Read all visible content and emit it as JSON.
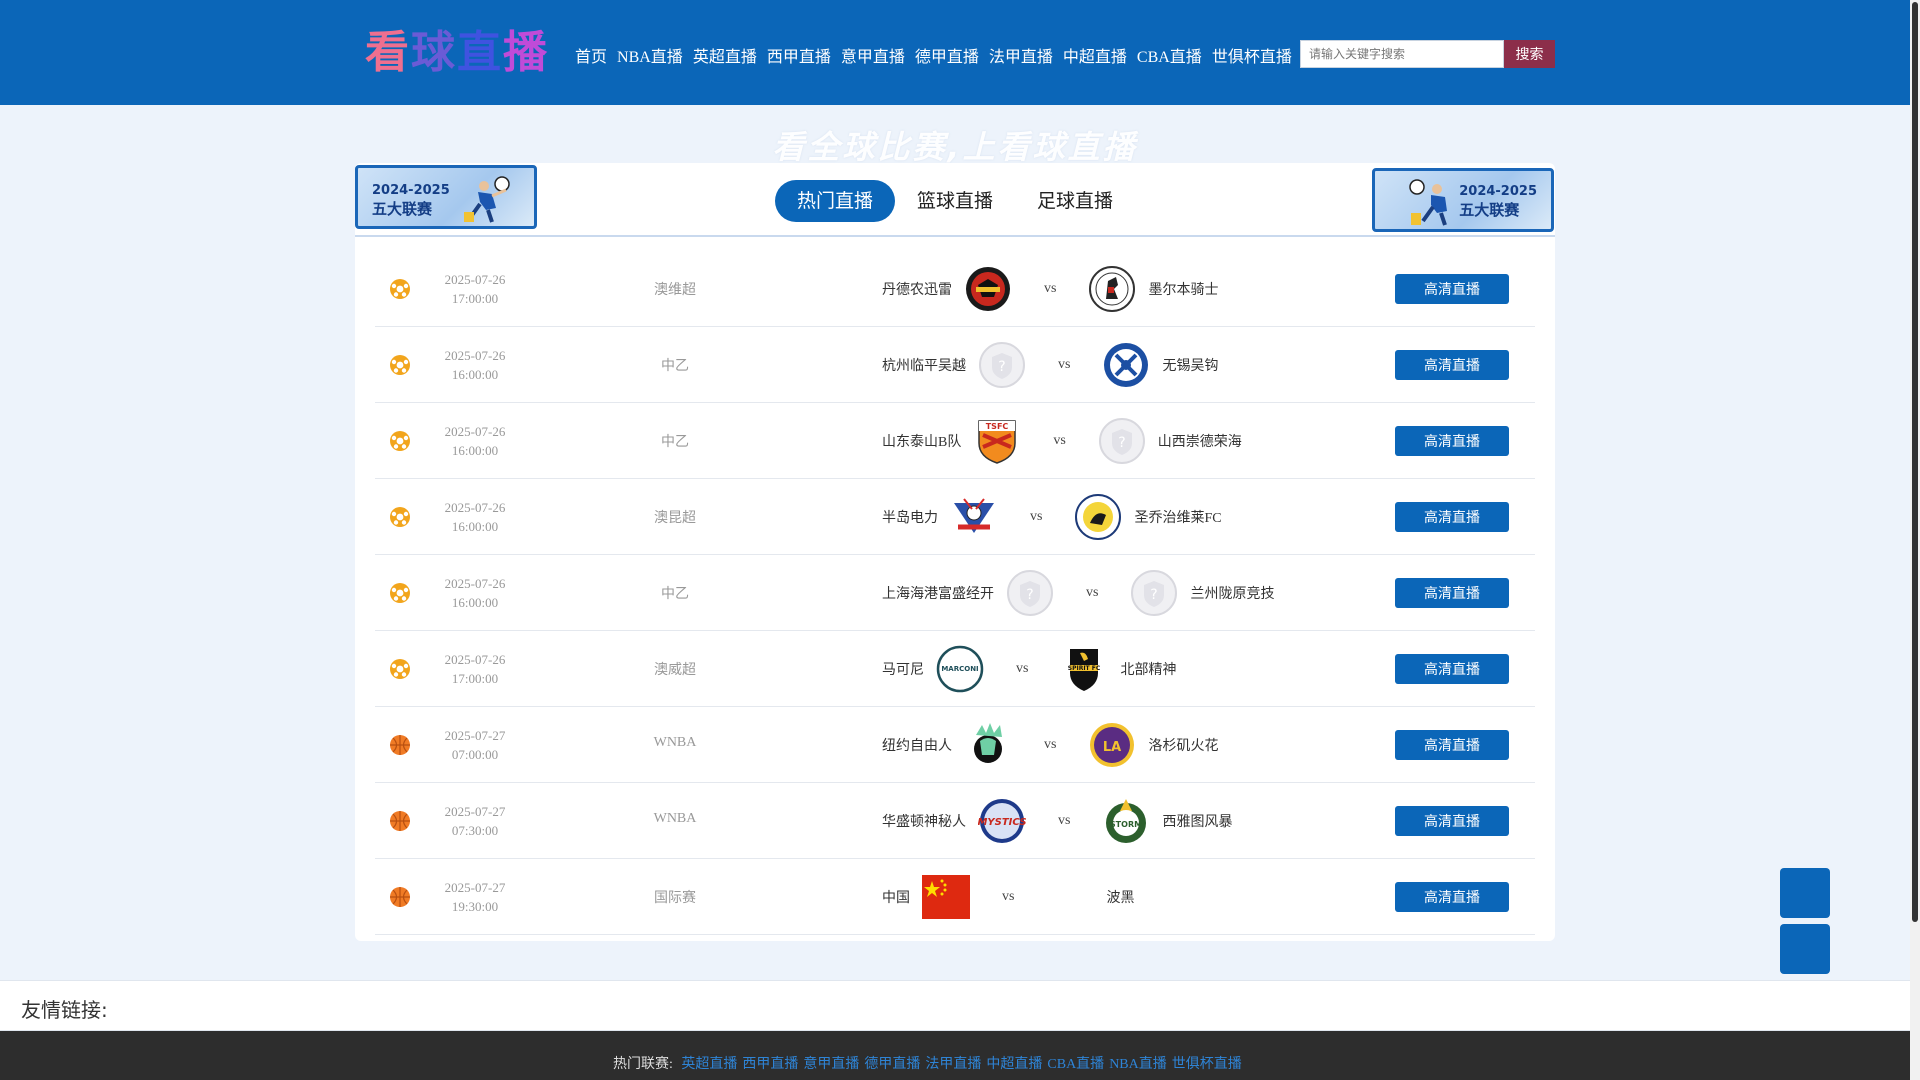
{
  "header": {
    "logo_chars": [
      "看",
      "球",
      "直",
      "播"
    ],
    "nav": [
      "首页",
      "NBA直播",
      "英超直播",
      "西甲直播",
      "意甲直播",
      "德甲直播",
      "法甲直播",
      "中超直播",
      "CBA直播",
      "世俱杯直播"
    ],
    "search_placeholder": "请输入关键字搜索",
    "search_button": "搜索"
  },
  "slogan": "看全球比赛,上看球直播",
  "banners": {
    "left": {
      "year": "2024-2025",
      "name": "五大联赛"
    },
    "right": {
      "year": "2024-2025",
      "name": "五大联赛"
    }
  },
  "tabs": [
    "热门直播",
    "篮球直播",
    "足球直播"
  ],
  "matches": [
    {
      "sport": "football",
      "date": "2025-07-26",
      "time": "17:00:00",
      "league": "澳维超",
      "home": "丹德农迅雷",
      "away": "墨尔本骑士",
      "home_logo": "thunder-crest",
      "away_logo": "knights-crest",
      "button": "高清直播"
    },
    {
      "sport": "football",
      "date": "2025-07-26",
      "time": "16:00:00",
      "league": "中乙",
      "home": "杭州临平吴越",
      "away": "无锡吴钩",
      "home_logo": "placeholder",
      "away_logo": "wuxi-crest",
      "button": "高清直播"
    },
    {
      "sport": "football",
      "date": "2025-07-26",
      "time": "16:00:00",
      "league": "中乙",
      "home": "山东泰山B队",
      "away": "山西崇德荣海",
      "home_logo": "taishan-crest",
      "away_logo": "placeholder",
      "button": "高清直播"
    },
    {
      "sport": "football",
      "date": "2025-07-26",
      "time": "16:00:00",
      "league": "澳昆超",
      "home": "半岛电力",
      "away": "圣乔治维莱FC",
      "home_logo": "power-crest",
      "away_logo": "stgeorge-crest",
      "button": "高清直播"
    },
    {
      "sport": "football",
      "date": "2025-07-26",
      "time": "16:00:00",
      "league": "中乙",
      "home": "上海海港富盛经开",
      "away": "兰州陇原竞技",
      "home_logo": "placeholder",
      "away_logo": "placeholder",
      "button": "高清直播"
    },
    {
      "sport": "football",
      "date": "2025-07-26",
      "time": "17:00:00",
      "league": "澳威超",
      "home": "马可尼",
      "away": "北部精神",
      "home_logo": "marconi-crest",
      "away_logo": "spirit-crest",
      "button": "高清直播"
    },
    {
      "sport": "basketball",
      "date": "2025-07-27",
      "time": "07:00:00",
      "league": "WNBA",
      "home": "纽约自由人",
      "away": "洛杉矶火花",
      "home_logo": "liberty-crest",
      "away_logo": "sparks-crest",
      "button": "高清直播"
    },
    {
      "sport": "basketball",
      "date": "2025-07-27",
      "time": "07:30:00",
      "league": "WNBA",
      "home": "华盛顿神秘人",
      "away": "西雅图风暴",
      "home_logo": "mystics-crest",
      "away_logo": "storm-crest",
      "button": "高清直播"
    },
    {
      "sport": "basketball",
      "date": "2025-07-27",
      "time": "19:30:00",
      "league": "国际赛",
      "home": "中国",
      "away": "波黑",
      "home_logo": "china-flag",
      "away_logo": "none",
      "button": "高清直播"
    }
  ],
  "vs_label": "vs",
  "links": {
    "title": "友情链接:"
  },
  "footer": {
    "label": "热门联赛:",
    "items": [
      "英超直播",
      "西甲直播",
      "意甲直播",
      "德甲直播",
      "法甲直播",
      "中超直播",
      "CBA直播",
      "NBA直播",
      "世俱杯直播"
    ]
  },
  "colors": {
    "primary": "#0b66b8",
    "search_button": "#8c2e4a",
    "footer_bg": "#2d2d2d",
    "link": "#2e84d6"
  }
}
